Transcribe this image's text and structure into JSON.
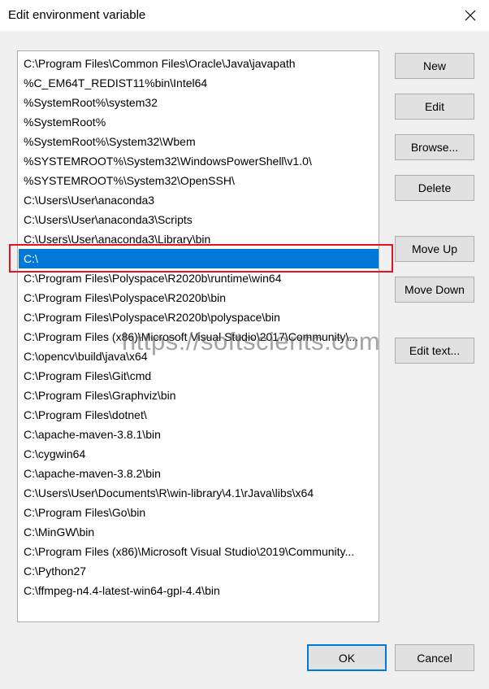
{
  "window": {
    "title": "Edit environment variable"
  },
  "list": {
    "items": [
      "C:\\Program Files\\Common Files\\Oracle\\Java\\javapath",
      "%C_EM64T_REDIST11%bin\\Intel64",
      "%SystemRoot%\\system32",
      "%SystemRoot%",
      "%SystemRoot%\\System32\\Wbem",
      "%SYSTEMROOT%\\System32\\WindowsPowerShell\\v1.0\\",
      "%SYSTEMROOT%\\System32\\OpenSSH\\",
      "C:\\Users\\User\\anaconda3",
      "C:\\Users\\User\\anaconda3\\Scripts",
      "C:\\Users\\User\\anaconda3\\Library\\bin",
      "C:\\",
      "C:\\Program Files\\Polyspace\\R2020b\\runtime\\win64",
      "C:\\Program Files\\Polyspace\\R2020b\\bin",
      "C:\\Program Files\\Polyspace\\R2020b\\polyspace\\bin",
      "C:\\Program Files (x86)\\Microsoft Visual Studio\\2017\\Community\\...",
      "C:\\opencv\\build\\java\\x64",
      "C:\\Program Files\\Git\\cmd",
      "C:\\Program Files\\Graphviz\\bin",
      "C:\\Program Files\\dotnet\\",
      "C:\\apache-maven-3.8.1\\bin",
      "C:\\cygwin64",
      "C:\\apache-maven-3.8.2\\bin",
      "C:\\Users\\User\\Documents\\R\\win-library\\4.1\\rJava\\libs\\x64",
      "C:\\Program Files\\Go\\bin",
      "C:\\MinGW\\bin",
      "C:\\Program Files (x86)\\Microsoft Visual Studio\\2019\\Community...",
      "C:\\Python27",
      "C:\\ffmpeg-n4.4-latest-win64-gpl-4.4\\bin"
    ],
    "selected_index": 10
  },
  "buttons": {
    "new": "New",
    "edit": "Edit",
    "browse": "Browse...",
    "delete": "Delete",
    "move_up": "Move Up",
    "move_down": "Move Down",
    "edit_text": "Edit text...",
    "ok": "OK",
    "cancel": "Cancel"
  },
  "watermark": "https://softscients.com",
  "colors": {
    "selection": "#0078d7",
    "highlight_border": "#e81123"
  }
}
